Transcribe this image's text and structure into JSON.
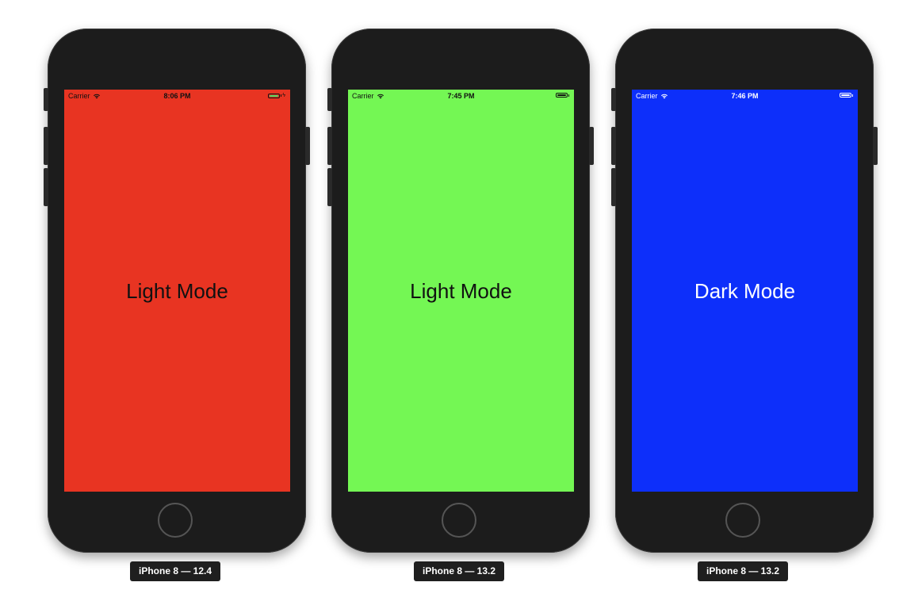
{
  "devices": [
    {
      "screen_color": "#e83422",
      "text_color": "#111111",
      "statusbar": {
        "carrier": "Carrier",
        "time": "8:06 PM",
        "battery_fill_color": "#4cd964",
        "battery_outline_color": "#111111",
        "charging": true,
        "charging_symbol": "ϟ"
      },
      "mode_label": "Light Mode",
      "caption": "iPhone 8 — 12.4"
    },
    {
      "screen_color": "#74f754",
      "text_color": "#111111",
      "statusbar": {
        "carrier": "Carrier",
        "time": "7:45 PM",
        "battery_fill_color": "#111111",
        "battery_outline_color": "#111111",
        "charging": false,
        "charging_symbol": ""
      },
      "mode_label": "Light Mode",
      "caption": "iPhone 8 — 13.2"
    },
    {
      "screen_color": "#0d2ffa",
      "text_color": "#ffffff",
      "statusbar": {
        "carrier": "Carrier",
        "time": "7:46 PM",
        "battery_fill_color": "#ffffff",
        "battery_outline_color": "#ffffff",
        "charging": false,
        "charging_symbol": ""
      },
      "mode_label": "Dark Mode",
      "caption": "iPhone 8 — 13.2"
    }
  ],
  "icons": {
    "wifi": "wifi-icon",
    "battery": "battery-icon",
    "home": "home-button"
  },
  "colors": {
    "device_body": "#1c1c1c",
    "caption_bg": "#1f1f1f"
  }
}
